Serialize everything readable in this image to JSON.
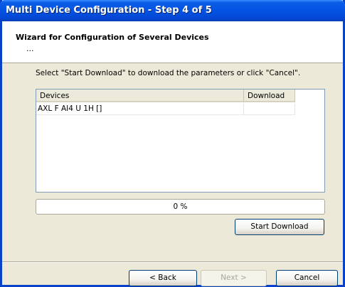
{
  "window": {
    "title": "Multi Device Configuration - Step 4 of 5"
  },
  "header": {
    "title": "Wizard for Configuration of Several Devices",
    "subtitle": "..."
  },
  "instruction": "Select \"Start Download\" to download the parameters or click \"Cancel\".",
  "device_list": {
    "columns": [
      "Devices",
      "Download"
    ],
    "rows": [
      {
        "device": "AXL F AI4 U 1H []",
        "download": ""
      }
    ]
  },
  "progress": {
    "percent": 0,
    "label": "0 %"
  },
  "buttons": {
    "start_download": "Start Download",
    "back": "< Back",
    "next": "Next >",
    "cancel": "Cancel"
  }
}
